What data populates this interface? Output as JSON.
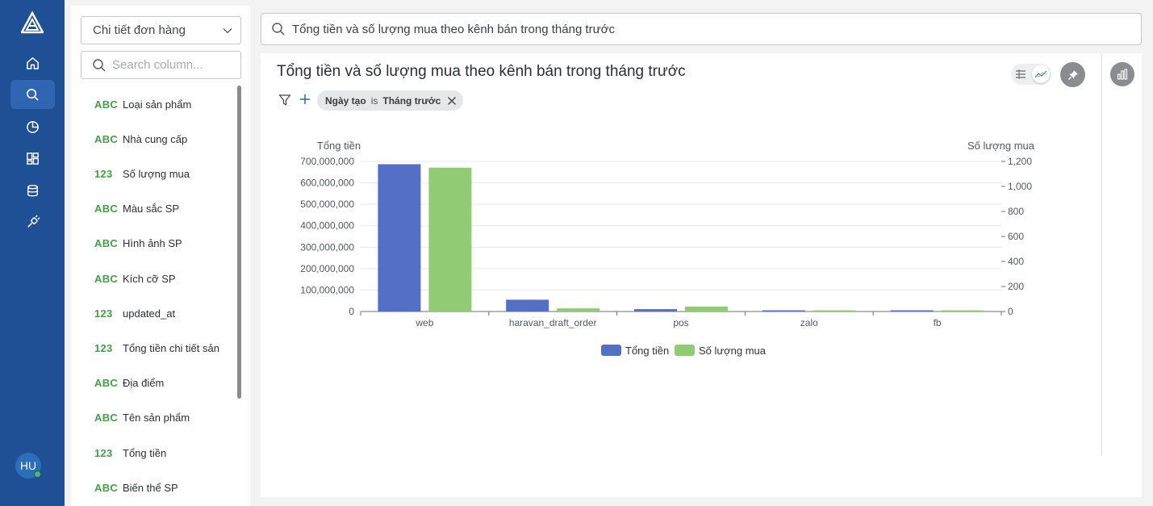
{
  "nav": {
    "items": [
      {
        "icon": "home-icon"
      },
      {
        "icon": "search-icon",
        "active": true
      },
      {
        "icon": "pie-chart-icon"
      },
      {
        "icon": "dashboard-icon"
      },
      {
        "icon": "database-icon"
      },
      {
        "icon": "plug-icon"
      }
    ],
    "avatar": "HU"
  },
  "columns": {
    "dataset": "Chi tiết đơn hàng",
    "search_placeholder": "Search column...",
    "items": [
      {
        "type": "ABC",
        "name": "Loại sản phẩm"
      },
      {
        "type": "ABC",
        "name": "Nhà cung cấp"
      },
      {
        "type": "123",
        "name": "Số lượng mua"
      },
      {
        "type": "ABC",
        "name": "Màu sắc SP"
      },
      {
        "type": "ABC",
        "name": "Hình ảnh SP"
      },
      {
        "type": "ABC",
        "name": "Kích cỡ SP"
      },
      {
        "type": "123",
        "name": "updated_at"
      },
      {
        "type": "123",
        "name": "Tổng tiền chi tiết sản"
      },
      {
        "type": "ABC",
        "name": "Địa điểm"
      },
      {
        "type": "ABC",
        "name": "Tên sản phẩm"
      },
      {
        "type": "123",
        "name": "Tổng tiền"
      },
      {
        "type": "ABC",
        "name": "Biến thể SP"
      }
    ]
  },
  "query": {
    "text": "Tổng tiền và số lượng mua theo kênh bán trong tháng trước"
  },
  "card": {
    "title": "Tổng tiền và số lượng mua theo kênh bán trong tháng trước",
    "filter": {
      "field": "Ngày tạo",
      "operator": "is",
      "value": "Tháng trước"
    }
  },
  "colors": {
    "series1": "#5470c6",
    "series2": "#91cc75",
    "nav": "#1f4f95"
  },
  "chart_data": {
    "type": "bar",
    "categories": [
      "web",
      "haravan_draft_order",
      "pos",
      "zalo",
      "fb"
    ],
    "series": [
      {
        "name": "Tổng tiền",
        "axis": "left",
        "values": [
          687000000,
          55000000,
          11000000,
          4000000,
          2000000
        ]
      },
      {
        "name": "Số lượng mua",
        "axis": "right",
        "values": [
          1150,
          25,
          40,
          5,
          7
        ]
      }
    ],
    "ylabel_left": "Tổng tiền",
    "ylabel_right": "Số lượng mua",
    "ylim_left": [
      0,
      700000000
    ],
    "ylim_right": [
      0,
      1200
    ],
    "yticks_left": [
      "0",
      "100,000,000",
      "200,000,000",
      "300,000,000",
      "400,000,000",
      "500,000,000",
      "600,000,000",
      "700,000,000"
    ],
    "yticks_right": [
      "0",
      "200",
      "400",
      "600",
      "800",
      "1,000",
      "1,200"
    ],
    "legend": "bottom-center",
    "grid": true
  }
}
